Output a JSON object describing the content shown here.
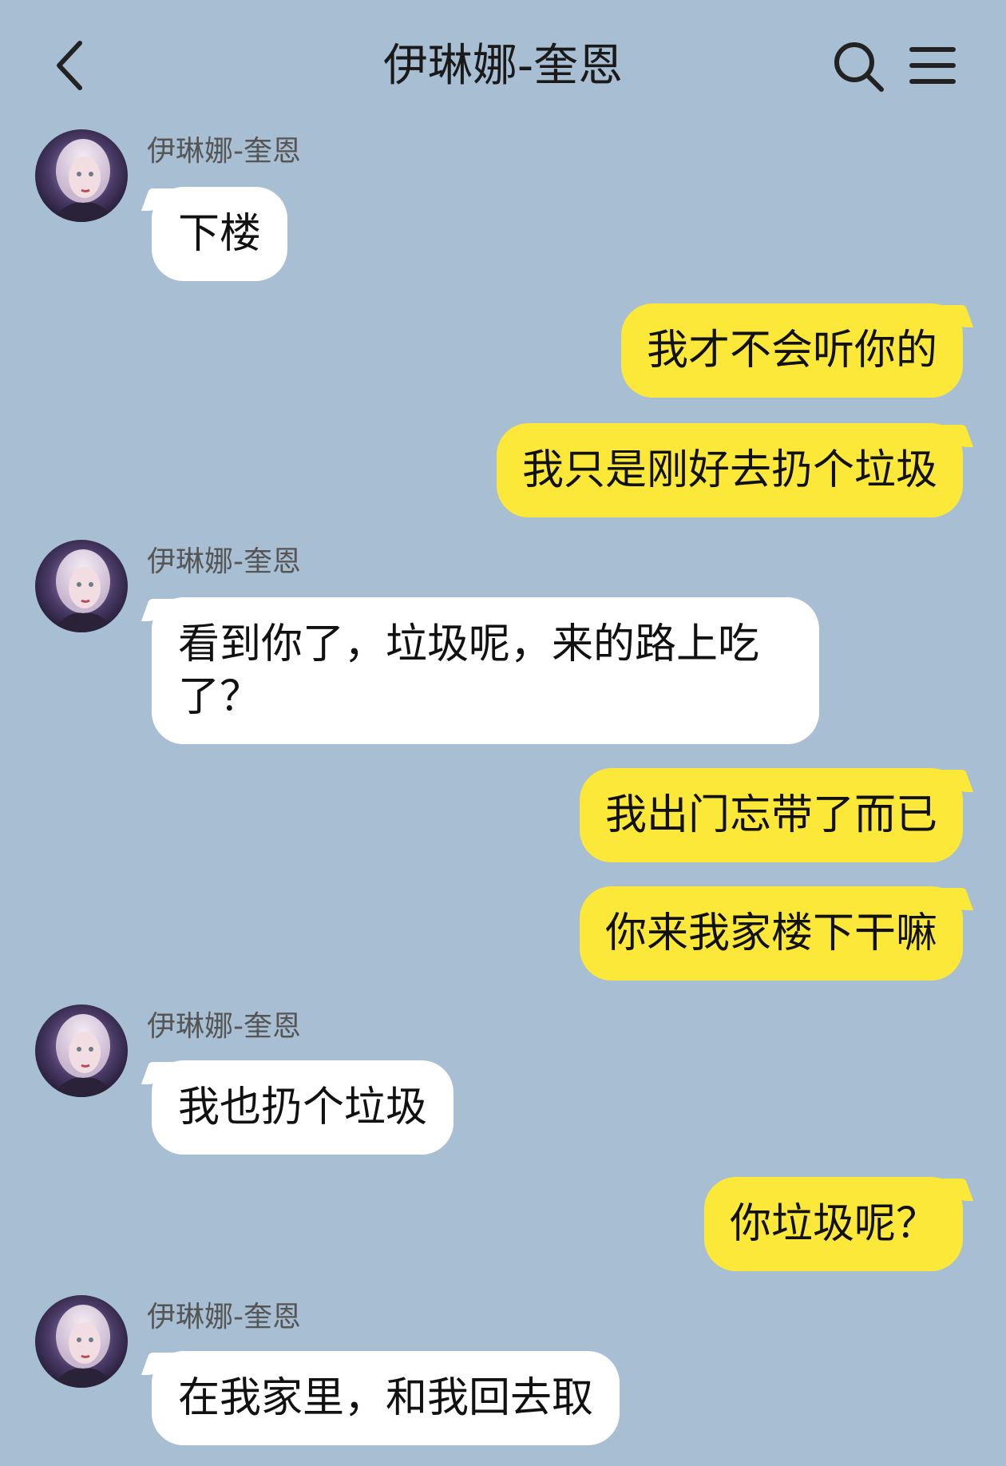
{
  "header": {
    "title": "伊琳娜-奎恩",
    "back_icon": "chevron-left-icon",
    "search_icon": "search-icon",
    "menu_icon": "menu-icon"
  },
  "contact": {
    "name": "伊琳娜-奎恩"
  },
  "messages": [
    {
      "side": "left",
      "text": "下楼"
    },
    {
      "side": "right",
      "text": "我才不会听你的"
    },
    {
      "side": "right",
      "text": "我只是刚好去扔个垃圾"
    },
    {
      "side": "left",
      "text": "看到你了，垃圾呢，来的路上吃了？"
    },
    {
      "side": "right",
      "text": "我出门忘带了而已"
    },
    {
      "side": "right",
      "text": "你来我家楼下干嘛"
    },
    {
      "side": "left",
      "text": "我也扔个垃圾"
    },
    {
      "side": "right",
      "text": "你垃圾呢？"
    },
    {
      "side": "left",
      "text": "在我家里，和我回去取"
    }
  ],
  "colors": {
    "background": "#a8bfd3",
    "incoming_bubble": "#ffffff",
    "outgoing_bubble": "#fce839"
  }
}
